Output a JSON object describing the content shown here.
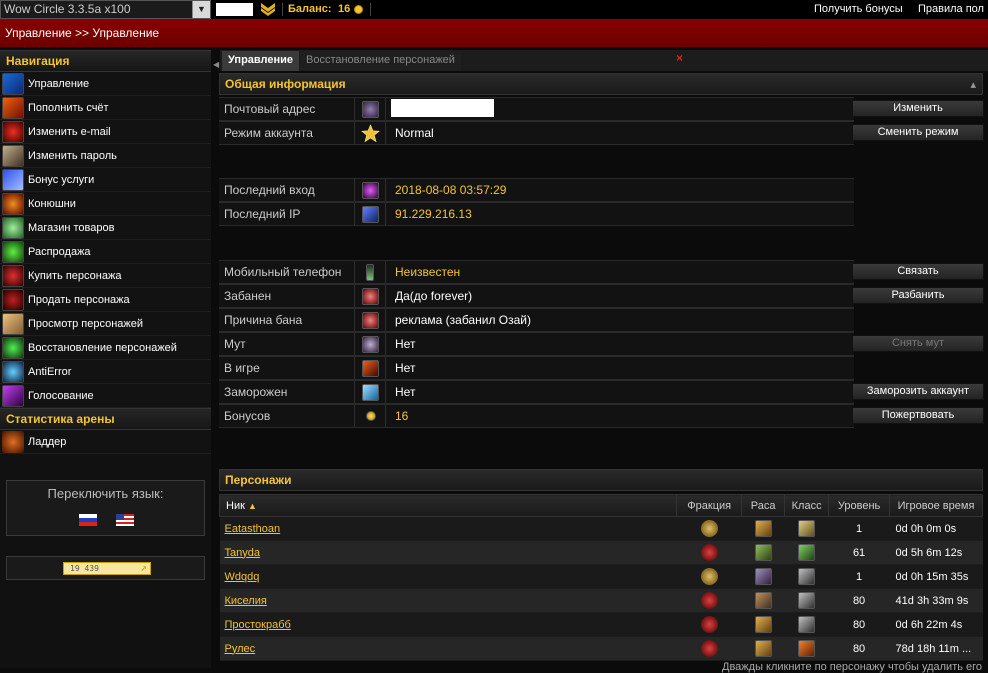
{
  "top": {
    "server": "Wow Circle 3.3.5a x100",
    "balance_label": "Баланс:",
    "balance_value": "16",
    "links": [
      "Получить бонусы",
      "Правила пол"
    ]
  },
  "breadcrumb": "Управление >> Управление",
  "sidebar": {
    "nav_title": "Навигация",
    "items": [
      "Управление",
      "Пополнить счёт",
      "Изменить e-mail",
      "Изменить пароль",
      "Бонус услуги",
      "Конюшни",
      "Магазин товаров",
      "Распродажа",
      "Купить персонажа",
      "Продать персонажа",
      "Просмотр персонажей",
      "Восстановление персонажей",
      "AntiError",
      "Голосование"
    ],
    "arena_title": "Статистика арены",
    "arena_items": [
      "Ладдер"
    ],
    "lang_title": "Переключить язык:",
    "counter": "19 439"
  },
  "tabs": [
    "Управление",
    "Восстановление персонажей"
  ],
  "info": {
    "title": "Общая информация",
    "rows": [
      {
        "label": "Почтовый адрес",
        "value": ""
      },
      {
        "label": "Режим аккаунта",
        "value": "Normal"
      },
      {
        "label": "Последний вход",
        "value": "2018-08-08 03:57:29"
      },
      {
        "label": "Последний IP",
        "value": "91.229.216.13"
      },
      {
        "label": "Мобильный телефон",
        "value": "Неизвестен"
      },
      {
        "label": "Забанен",
        "value": "Да(до forever)"
      },
      {
        "label": "Причина бана",
        "value": "реклама (забанил Озай)"
      },
      {
        "label": "Мут",
        "value": "Нет"
      },
      {
        "label": "В игре",
        "value": "Нет"
      },
      {
        "label": "Заморожен",
        "value": "Нет"
      },
      {
        "label": "Бонусов",
        "value": "16"
      }
    ],
    "buttons": [
      "Изменить",
      "Сменить режим",
      "Связать",
      "Разбанить",
      "Снять мут",
      "Заморозить аккаунт",
      "Пожертвовать"
    ]
  },
  "characters": {
    "title": "Персонажи",
    "headers": [
      "Ник",
      "Фракция",
      "Раса",
      "Класс",
      "Уровень",
      "Игровое время"
    ],
    "rows": [
      {
        "name": "Eatasthoan",
        "level": "1",
        "time": "0d 0h 0m 0s"
      },
      {
        "name": "Tanyda",
        "level": "61",
        "time": "0d 5h 6m 12s"
      },
      {
        "name": "Wdqdq",
        "level": "1",
        "time": "0d 0h 15m 35s"
      },
      {
        "name": "Киселия",
        "level": "80",
        "time": "41d 3h 33m 9s"
      },
      {
        "name": "Простокрабб",
        "level": "80",
        "time": "0d 6h 22m 4s"
      },
      {
        "name": "Рулес",
        "level": "80",
        "time": "78d 18h 11m ..."
      }
    ],
    "footer": "Дважды кликните по персонажу чтобы удалить его"
  }
}
